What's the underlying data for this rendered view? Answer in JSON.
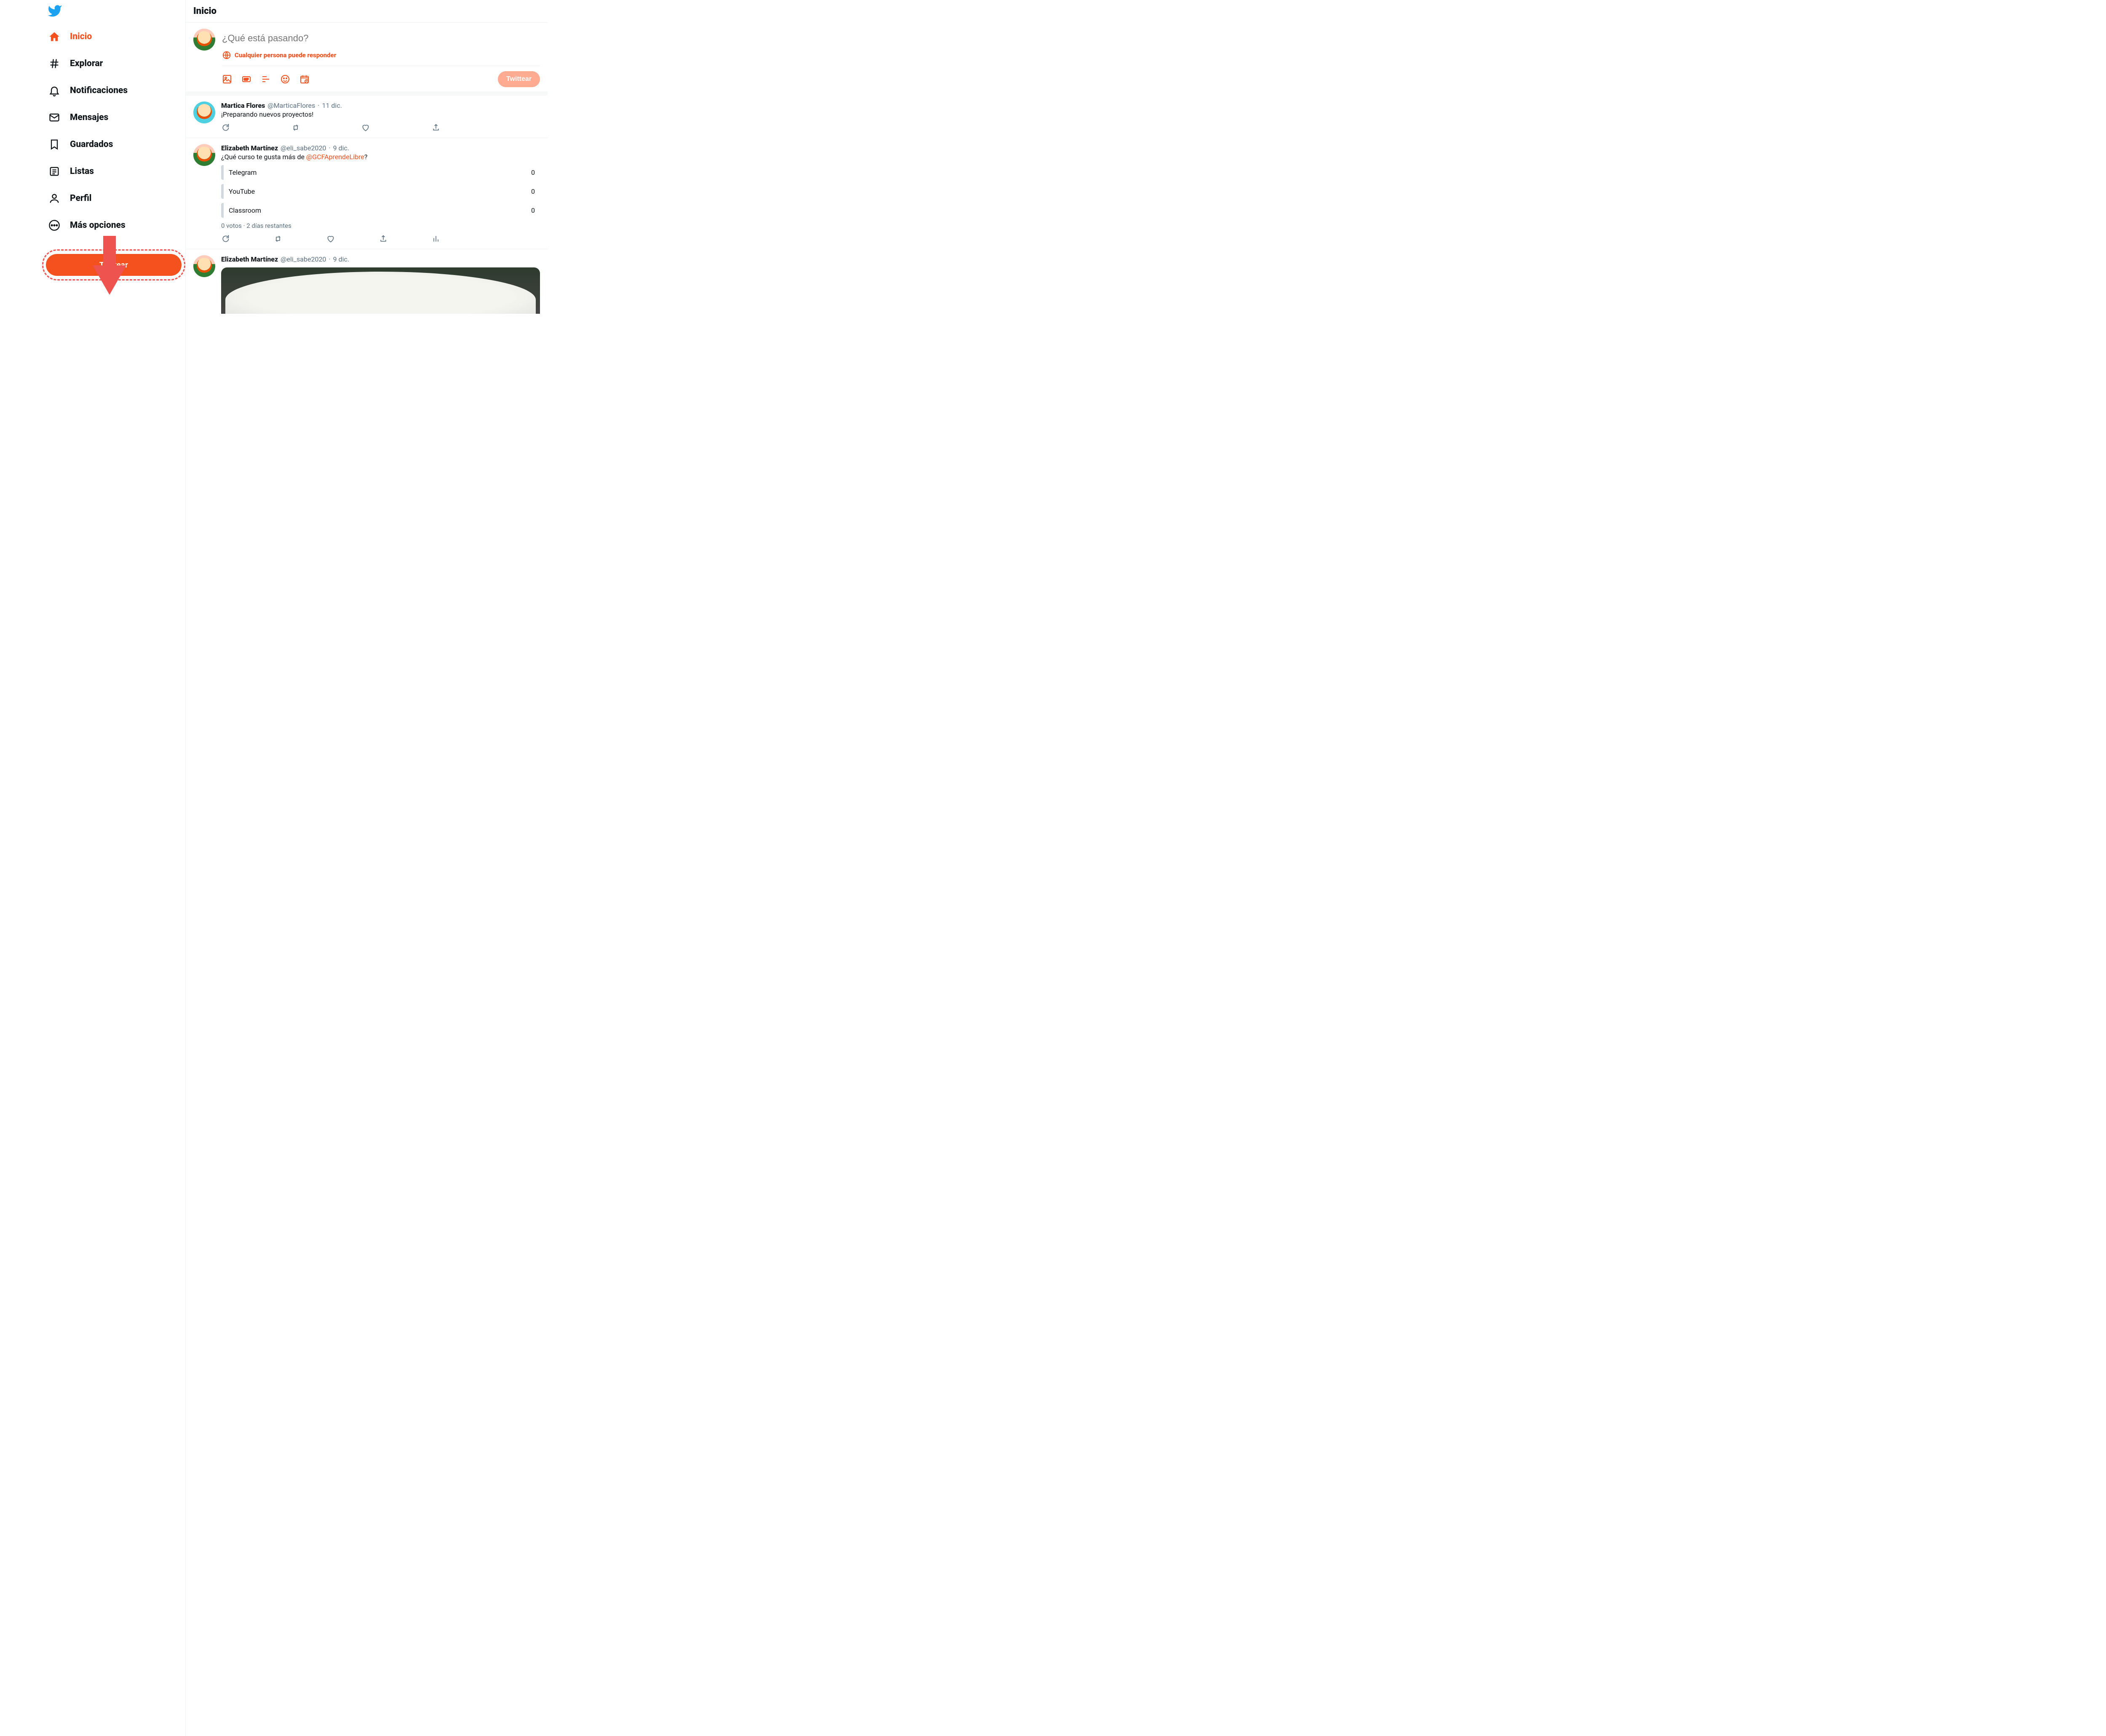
{
  "colors": {
    "accent": "#f4511e",
    "twitter_blue": "#1da1f2",
    "arrow": "#ef5350"
  },
  "sidebar": {
    "items": [
      {
        "label": "Inicio",
        "icon": "home-icon",
        "active": true
      },
      {
        "label": "Explorar",
        "icon": "hash-icon",
        "active": false
      },
      {
        "label": "Notificaciones",
        "icon": "bell-icon",
        "active": false
      },
      {
        "label": "Mensajes",
        "icon": "envelope-icon",
        "active": false
      },
      {
        "label": "Guardados",
        "icon": "bookmark-icon",
        "active": false
      },
      {
        "label": "Listas",
        "icon": "list-icon",
        "active": false
      },
      {
        "label": "Perfil",
        "icon": "profile-icon",
        "active": false
      },
      {
        "label": "Más opciones",
        "icon": "more-icon",
        "active": false
      }
    ],
    "tweet_button": "Twittear"
  },
  "header": {
    "title": "Inicio"
  },
  "compose": {
    "placeholder": "¿Qué está pasando?",
    "reply_setting": "Cualquier persona puede responder",
    "submit_label": "Twittear"
  },
  "feed": [
    {
      "name": "Martica Flores",
      "handle": "@MarticaFlores",
      "date": "11 dic.",
      "text": "¡Preparando nuevos proyectos!",
      "avatar_style": "teal"
    },
    {
      "name": "Elizabeth Martínez",
      "handle": "@eli_sabe2020",
      "date": "9 dic.",
      "text_prefix": "¿Qué curso te gusta más de ",
      "mention": "@GCFAprendeLibre",
      "text_suffix": "?",
      "poll": {
        "options": [
          "Telegram",
          "YouTube",
          "Classroom"
        ],
        "right_marker": "0",
        "meta": "0 votos · 2 días restantes"
      },
      "show_analytics": true
    },
    {
      "name": "Elizabeth Martínez",
      "handle": "@eli_sabe2020",
      "date": "9 dic.",
      "has_media": true
    }
  ]
}
